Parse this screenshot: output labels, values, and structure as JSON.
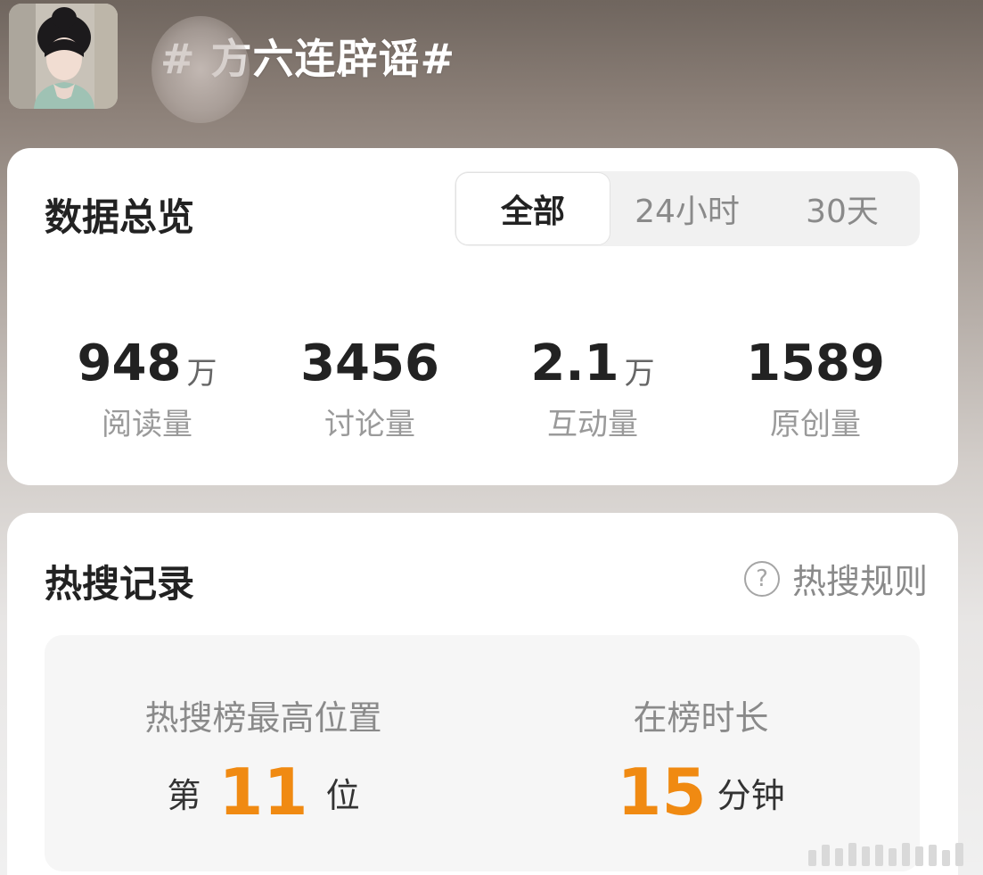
{
  "header": {
    "title": "#  方六连辟谣#",
    "cover_alt": "topic-cover-image"
  },
  "overview": {
    "title": "数据总览",
    "tabs": [
      {
        "label": "全部",
        "active": true
      },
      {
        "label": "24小时",
        "active": false
      },
      {
        "label": "30天",
        "active": false
      }
    ],
    "stats": [
      {
        "value": "948",
        "unit": "万",
        "label": "阅读量"
      },
      {
        "value": "3456",
        "unit": "",
        "label": "讨论量"
      },
      {
        "value": "2.1",
        "unit": "万",
        "label": "互动量"
      },
      {
        "value": "1589",
        "unit": "",
        "label": "原创量"
      }
    ]
  },
  "hot_search": {
    "title": "热搜记录",
    "rules_label": "热搜规则",
    "help_icon": "question-circle-icon",
    "peak": {
      "label": "热搜榜最高位置",
      "prefix": "第",
      "value": "11",
      "suffix": "位"
    },
    "duration": {
      "label": "在榜时长",
      "value": "15",
      "suffix": "分钟"
    },
    "accent_color": "#f08a12"
  }
}
